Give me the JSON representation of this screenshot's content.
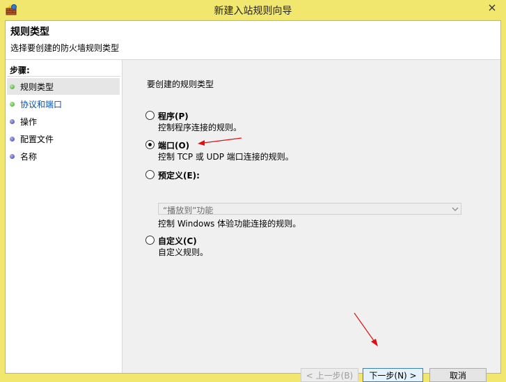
{
  "window": {
    "title": "新建入站规则向导",
    "icons": {
      "app": "firewall-wizard-icon",
      "close": "close-icon"
    }
  },
  "header": {
    "title": "规则类型",
    "subtitle": "选择要创建的防火墙规则类型"
  },
  "steps": {
    "label": "步骤:",
    "items": [
      {
        "label": "规则类型",
        "state": "current",
        "dot_color": "#3aa12a"
      },
      {
        "label": "协议和端口",
        "state": "link",
        "dot_color": "#3aa12a"
      },
      {
        "label": "操作",
        "state": "normal",
        "dot_color": "#3b3bb3"
      },
      {
        "label": "配置文件",
        "state": "normal",
        "dot_color": "#3b3bb3"
      },
      {
        "label": "名称",
        "state": "normal",
        "dot_color": "#3b3bb3"
      }
    ]
  },
  "main": {
    "question": "要创建的规则类型",
    "options": [
      {
        "label": "程序(P)",
        "desc": "控制程序连接的规则。",
        "checked": false
      },
      {
        "label": "端口(O)",
        "desc": "控制 TCP 或 UDP 端口连接的规则。",
        "checked": true
      },
      {
        "label": "预定义(E):",
        "desc": "控制 Windows 体验功能连接的规则。",
        "checked": false
      },
      {
        "label": "自定义(C)",
        "desc": "自定义规则。",
        "checked": false
      }
    ],
    "predefined_select": {
      "value": "“播放到”功能",
      "enabled": false
    }
  },
  "buttons": {
    "back": "< 上一步(B)",
    "next": "下一步(N) >",
    "cancel": "取消"
  },
  "annotations": {
    "arrow_color": "#e01010"
  }
}
